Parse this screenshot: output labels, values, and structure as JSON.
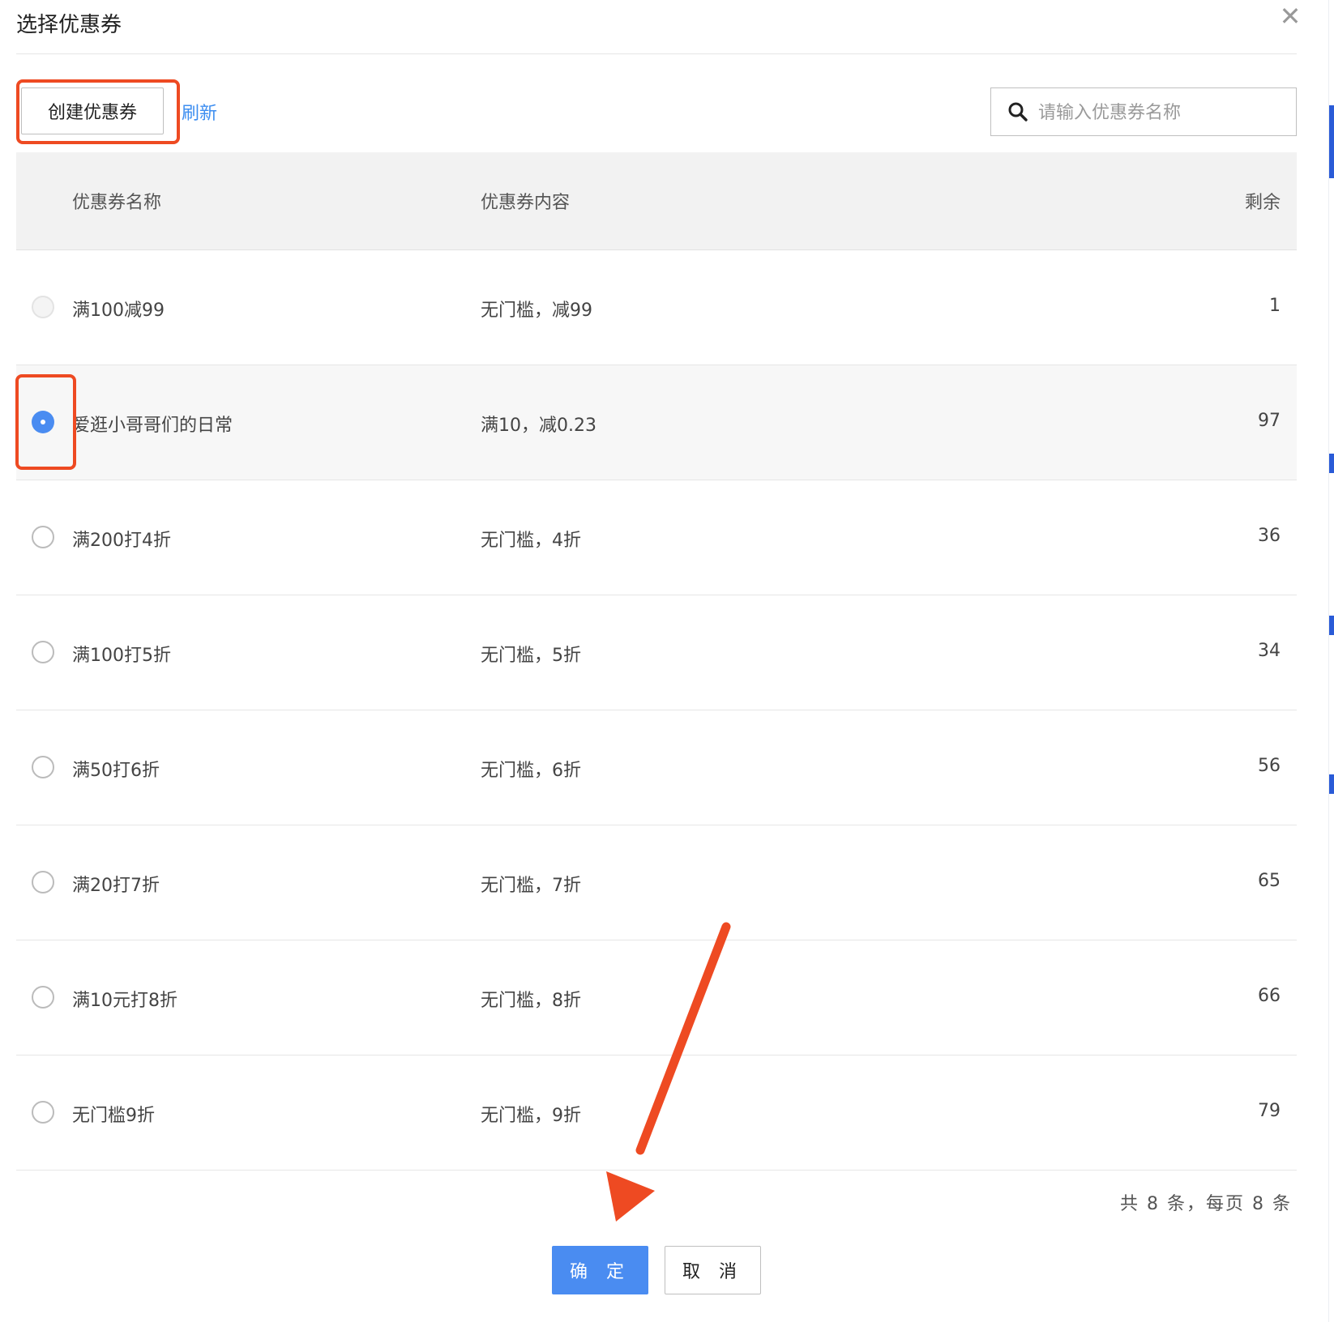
{
  "dialog": {
    "title": "选择优惠券",
    "close_glyph": "✕"
  },
  "toolbar": {
    "create_label": "创建优惠券",
    "refresh_label": "刷新",
    "search_placeholder": "请输入优惠券名称",
    "search_value": ""
  },
  "table": {
    "headers": {
      "name": "优惠券名称",
      "content": "优惠券内容",
      "remain": "剩余"
    },
    "rows": [
      {
        "name": "满100减99",
        "content": "无门槛，减99",
        "remain": "1",
        "state": "disabled"
      },
      {
        "name": "爱逛小哥哥们的日常",
        "content": "满10，减0.23",
        "remain": "97",
        "state": "checked"
      },
      {
        "name": "满200打4折",
        "content": "无门槛，4折",
        "remain": "36",
        "state": "unchecked"
      },
      {
        "name": "满100打5折",
        "content": "无门槛，5折",
        "remain": "34",
        "state": "unchecked"
      },
      {
        "name": "满50打6折",
        "content": "无门槛，6折",
        "remain": "56",
        "state": "unchecked"
      },
      {
        "name": "满20打7折",
        "content": "无门槛，7折",
        "remain": "65",
        "state": "unchecked"
      },
      {
        "name": "满10元打8折",
        "content": "无门槛，8折",
        "remain": "66",
        "state": "unchecked"
      },
      {
        "name": "无门槛9折",
        "content": "无门槛，9折",
        "remain": "79",
        "state": "unchecked"
      }
    ]
  },
  "pagination": {
    "text": "共 8 条，每页 8 条"
  },
  "footer": {
    "confirm_label": "确 定",
    "cancel_label": "取 消"
  },
  "colors": {
    "primary": "#4a8cf1",
    "link": "#3d8ef0",
    "annotation": "#ee4a22",
    "header_bg": "#f2f2f2"
  },
  "icons": {
    "search": "search-icon",
    "close": "close-icon",
    "arrow": "annotation-arrow"
  }
}
